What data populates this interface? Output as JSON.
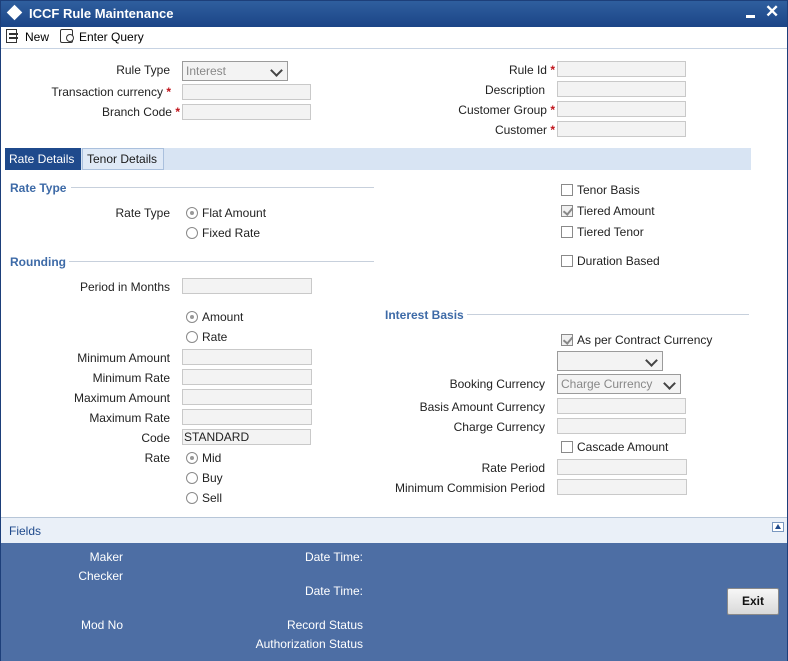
{
  "window": {
    "title": "ICCF Rule Maintenance"
  },
  "toolbar": {
    "new_label": "New",
    "enter_query_label": "Enter Query"
  },
  "header": {
    "rule_type_label": "Rule Type",
    "rule_type_value": "Interest",
    "transaction_currency_label": "Transaction currency",
    "branch_code_label": "Branch Code",
    "rule_id_label": "Rule Id",
    "description_label": "Description",
    "customer_group_label": "Customer Group",
    "customer_label": "Customer",
    "required_mark": "*"
  },
  "tabs": [
    {
      "label": "Rate Details",
      "active": true
    },
    {
      "label": "Tenor Details",
      "active": false
    }
  ],
  "rate_type": {
    "section_title": "Rate Type",
    "label": "Rate Type",
    "options": [
      {
        "label": "Flat Amount",
        "selected": true
      },
      {
        "label": "Fixed Rate",
        "selected": false
      }
    ]
  },
  "tier_options": [
    {
      "label": "Tenor Basis",
      "checked": false
    },
    {
      "label": "Tiered Amount",
      "checked": true
    },
    {
      "label": "Tiered Tenor",
      "checked": false
    },
    {
      "label": "Duration Based",
      "checked": false
    }
  ],
  "rounding": {
    "section_title": "Rounding",
    "period_in_months_label": "Period in Months",
    "options": [
      {
        "label": "Amount",
        "selected": true
      },
      {
        "label": "Rate",
        "selected": false
      }
    ],
    "minimum_amount_label": "Minimum Amount",
    "minimum_rate_label": "Minimum Rate",
    "maximum_amount_label": "Maximum Amount",
    "maximum_rate_label": "Maximum Rate",
    "code_label": "Code",
    "code_value": "STANDARD",
    "rate_label": "Rate",
    "rate_options": [
      {
        "label": "Mid",
        "selected": true
      },
      {
        "label": "Buy",
        "selected": false
      },
      {
        "label": "Sell",
        "selected": false
      }
    ]
  },
  "interest_basis": {
    "section_title": "Interest Basis",
    "as_per_contract_currency_label": "As per Contract Currency",
    "as_per_contract_currency_checked": true,
    "unlabeled_select_value": "",
    "booking_currency_label": "Booking Currency",
    "booking_currency_value": "Charge Currency",
    "basis_amount_currency_label": "Basis Amount Currency",
    "charge_currency_label": "Charge Currency",
    "cascade_amount_label": "Cascade Amount",
    "cascade_amount_checked": false,
    "rate_period_label": "Rate Period",
    "minimum_commision_period_label": "Minimum Commision Period"
  },
  "fields_bar": {
    "label": "Fields"
  },
  "footer": {
    "maker_label": "Maker",
    "checker_label": "Checker",
    "date_time_label": "Date Time:",
    "mod_no_label": "Mod No",
    "record_status_label": "Record Status",
    "authorization_status_label": "Authorization Status",
    "exit_label": "Exit"
  },
  "colors": {
    "title_bar": "#1b4587",
    "active_tab": "#1f4a8c",
    "section_title": "#3d6aa7",
    "required_mark": "#c0141b",
    "footer": "#4d6ea4"
  }
}
